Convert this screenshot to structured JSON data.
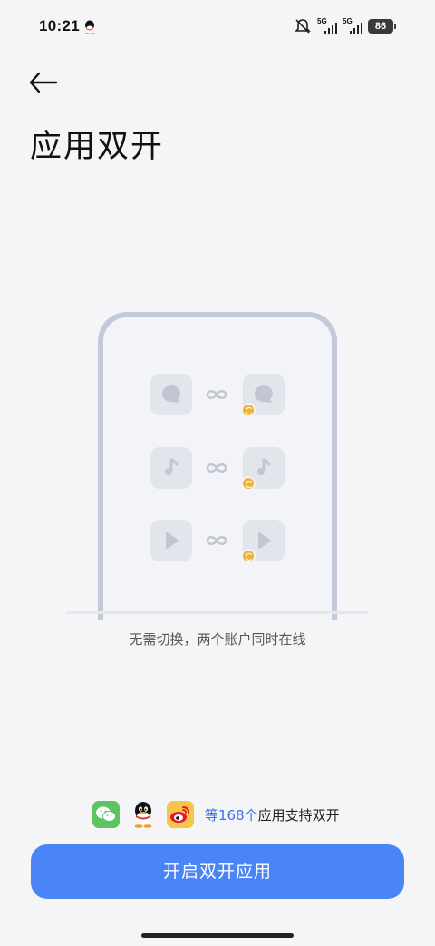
{
  "status_bar": {
    "time": "10:21",
    "signal1_label": "5G",
    "signal2_label": "5G",
    "battery": "86"
  },
  "header": {
    "back_icon": "arrow-left-icon",
    "title": "应用双开"
  },
  "illustration": {
    "rows": [
      {
        "icon": "message-bubble-icon"
      },
      {
        "icon": "music-note-icon"
      },
      {
        "icon": "play-icon"
      }
    ],
    "caption": "无需切换，两个账户同时在线"
  },
  "supported_apps": {
    "icons": [
      "wechat-icon",
      "qq-icon",
      "weibo-icon"
    ],
    "prefix": "等168个",
    "suffix": "应用支持双开"
  },
  "primary_button": "开启双开应用",
  "colors": {
    "accent": "#4a85f7",
    "highlight": "#3a72e8",
    "badge": "#f0b43a"
  }
}
